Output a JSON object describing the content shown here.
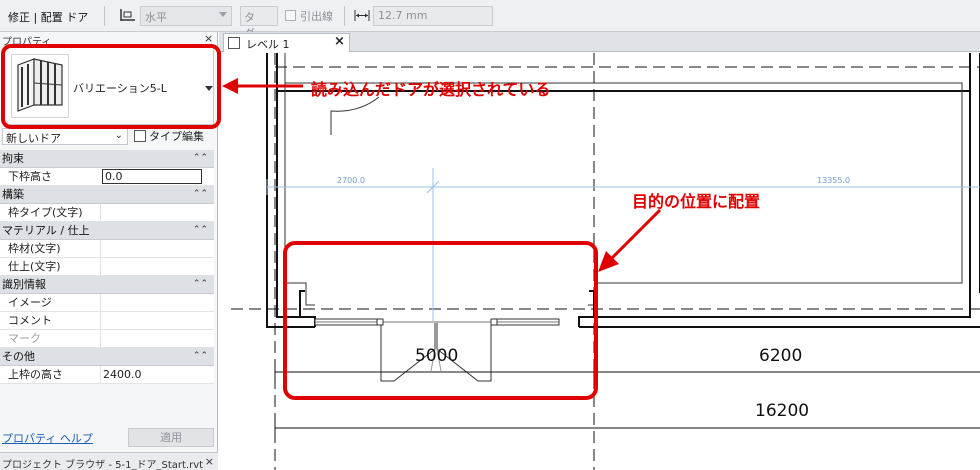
{
  "options_bar": {
    "mode_label": "修正 | 配置 ドア",
    "orientation_value": "水平",
    "tag_button": "タグ...",
    "leader_label": "引出線",
    "leader_value": "12.7 mm"
  },
  "properties": {
    "title": "プロパティ",
    "close": "×",
    "type_name": "バリエーション5-L",
    "instance_selector": "新しいドア",
    "edit_type_label": "タイプ編集",
    "groups": [
      {
        "label": "拘束",
        "rows": [
          {
            "key": "下枠高さ",
            "value": "0.0"
          }
        ]
      },
      {
        "label": "構築",
        "rows": [
          {
            "key": "枠タイプ(文字)",
            "value": ""
          }
        ]
      },
      {
        "label": "マテリアル / 仕上",
        "rows": [
          {
            "key": "枠材(文字)",
            "value": ""
          },
          {
            "key": "仕上(文字)",
            "value": ""
          }
        ]
      },
      {
        "label": "識別情報",
        "rows": [
          {
            "key": "イメージ",
            "value": ""
          },
          {
            "key": "コメント",
            "value": ""
          },
          {
            "key": "マーク",
            "value": ""
          }
        ]
      },
      {
        "label": "その他",
        "rows": [
          {
            "key": "上枠の高さ",
            "value": "2400.0"
          }
        ]
      }
    ],
    "help_link": "プロパティ ヘルプ",
    "apply_button": "適用",
    "project_browser": "プロジェクト ブラウザ - 5-1_ドア_Start.rvt",
    "project_browser_close": "×"
  },
  "view_tab": {
    "label": "レベル 1",
    "close": "×"
  },
  "drawing": {
    "dim_temp_left": "2700.0",
    "dim_temp_right": "13355.0",
    "dim_opening": "5000",
    "dim_right": "6200",
    "dim_total": "16200"
  },
  "callouts": {
    "loaded_door": "読み込んだドアが選択されている",
    "place_target": "目的の位置に配置"
  },
  "colors": {
    "callout_red": "#e00000",
    "temp_dim_blue": "#9ec2e8"
  }
}
